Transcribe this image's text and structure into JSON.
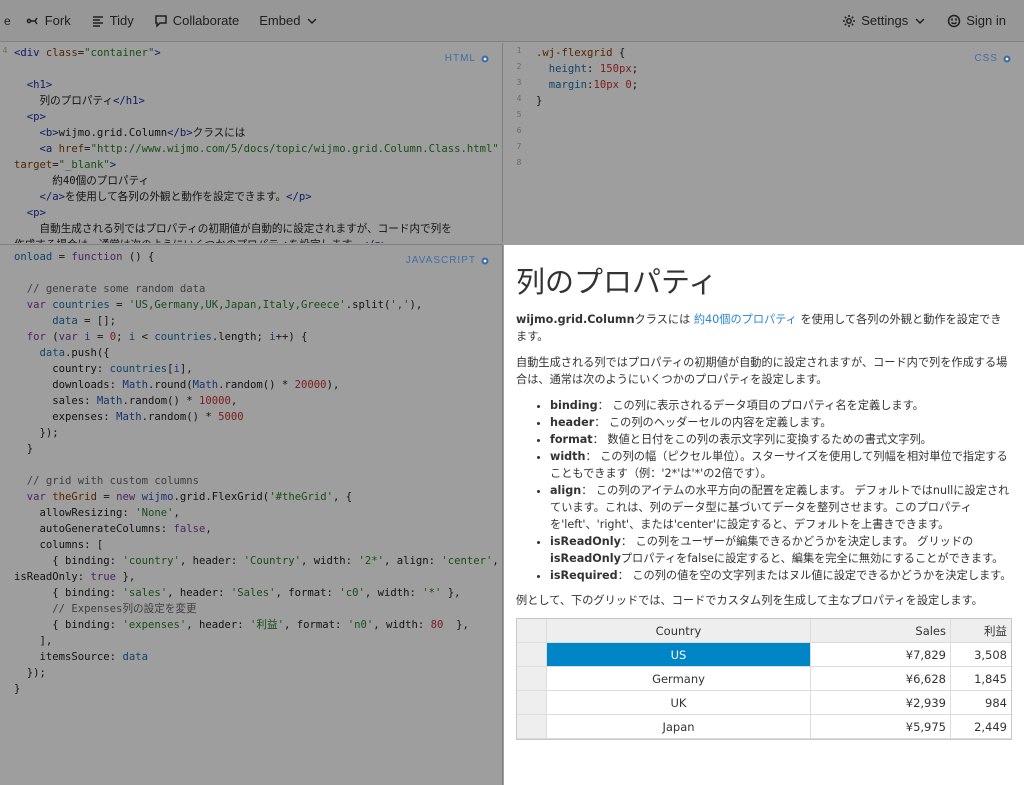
{
  "toolbar": {
    "fork": "Fork",
    "tidy": "Tidy",
    "collaborate": "Collaborate",
    "embed": "Embed",
    "settings": "Settings",
    "signin": "Sign in"
  },
  "panes": {
    "html_label": "HTML",
    "css_label": "CSS",
    "js_label": "JAVASCRIPT"
  },
  "html_code": [
    "<div class=\"container\">",
    "",
    "  <h1>",
    "    列のプロパティ</h1>",
    "  <p>",
    "    <b>wijmo.grid.Column</b>クラスには",
    "    <a href=\"http://www.wijmo.com/5/docs/topic/wijmo.grid.Column.Class.html\"",
    "target=\"_blank\">",
    "      約40個のプロパティ",
    "    </a>を使用して各列の外観と動作を設定できます。</p>",
    "  <p>",
    "    自動生成される列ではプロパティの初期値が自動的に設定されますが、コード内で列を",
    "作成する場合は、通常は次のようにいくつかのプロパティを設定します。</p>"
  ],
  "css_code": [
    ".wj-flexgrid {",
    "  height: 150px;",
    "  margin:10px 0;",
    "}"
  ],
  "js_code": [
    "onload = function () {",
    "",
    "  // generate some random data",
    "  var countries = 'US,Germany,UK,Japan,Italy,Greece'.split(','),",
    "      data = [];",
    "  for (var i = 0; i < countries.length; i++) {",
    "    data.push({",
    "      country: countries[i],",
    "      downloads: Math.round(Math.random() * 20000),",
    "      sales: Math.random() * 10000,",
    "      expenses: Math.random() * 5000",
    "    });",
    "  }",
    "",
    "  // grid with custom columns",
    "  var theGrid = new wijmo.grid.FlexGrid('#theGrid', {",
    "    allowResizing: 'None',",
    "    autoGenerateColumns: false,",
    "    columns: [",
    "      { binding: 'country', header: 'Country', width: '2*', align: 'center',",
    "isReadOnly: true },",
    "      { binding: 'sales', header: 'Sales', format: 'c0', width: '*' },",
    "      // Expenses列の設定を変更",
    "      { binding: 'expenses', header: '利益', format: 'n0', width: 80  },",
    "    ],",
    "    itemsSource: data",
    "  });",
    "}"
  ],
  "result": {
    "title": "列のプロパティ",
    "intro_bold": "wijmo.grid.Column",
    "intro_pre": "クラスには ",
    "intro_link": "約40個のプロパティ",
    "intro_post": " を使用して各列の外観と動作を設定できます。",
    "para2": "自動生成される列ではプロパティの初期値が自動的に設定されますが、コード内で列を作成する場合は、通常は次のようにいくつかのプロパティを設定します。",
    "props": [
      {
        "name": "binding",
        "desc": "： この列に表示されるデータ項目のプロパティ名を定義します。"
      },
      {
        "name": "header",
        "desc": "： この列のヘッダーセルの内容を定義します。"
      },
      {
        "name": "format",
        "desc": "： 数値と日付をこの列の表示文字列に変換するための書式文字列。"
      },
      {
        "name": "width",
        "desc": "： この列の幅（ピクセル単位）。スターサイズを使用して列幅を相対単位で指定することもできます（例：'2*'は'*'の2倍です）。"
      },
      {
        "name": "align",
        "desc": "： この列のアイテムの水平方向の配置を定義します。 デフォルトではnullに設定されています。これは、列のデータ型に基づいてデータを整列させます。このプロパティを'left'、'right'、または'center'に設定すると、デフォルトを上書きできます。"
      },
      {
        "name": "isReadOnly",
        "desc_pre": "： この列をユーザーが編集できるかどうかを決定します。 グリッドの",
        "desc_bold": "isReadOnly",
        "desc_post": "プロパティをfalseに設定すると、編集を完全に無効にすることができます。"
      },
      {
        "name": "isRequired",
        "desc": "： この列の値を空の文字列またはヌル値に設定できるかどうかを決定します。"
      }
    ],
    "para3": "例として、下のグリッドでは、コードでカスタム列を生成して主なプロパティを設定します。",
    "grid": {
      "headers": [
        "Country",
        "Sales",
        "利益"
      ],
      "rows": [
        [
          "US",
          "¥7,829",
          "3,508"
        ],
        [
          "Germany",
          "¥6,628",
          "1,845"
        ],
        [
          "UK",
          "¥2,939",
          "984"
        ],
        [
          "Japan",
          "¥5,975",
          "2,449"
        ]
      ]
    }
  }
}
